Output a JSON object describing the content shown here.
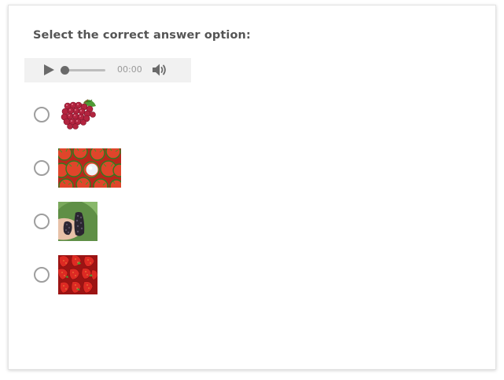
{
  "question": {
    "text": "Select the correct answer option:"
  },
  "audio_player": {
    "time": "00:00",
    "progress": 0,
    "play_icon": "play-icon",
    "volume_icon": "volume-icon"
  },
  "options": [
    {
      "image": "red-grapes",
      "selected": false
    },
    {
      "image": "rambutan",
      "selected": false
    },
    {
      "image": "blackberries",
      "selected": false
    },
    {
      "image": "strawberries",
      "selected": false
    }
  ],
  "colors": {
    "text": "#555555",
    "radio_border": "#9e9e9e",
    "player_bg": "#f1f1f1"
  }
}
